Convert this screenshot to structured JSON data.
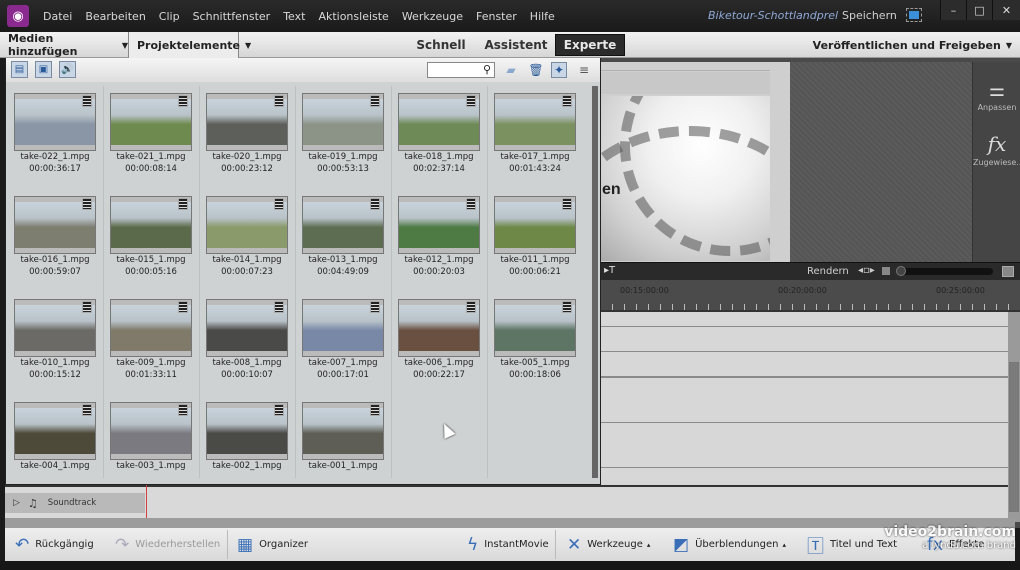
{
  "menubar": {
    "items": [
      "Datei",
      "Bearbeiten",
      "Clip",
      "Schnittfenster",
      "Text",
      "Aktionsleiste",
      "Werkzeuge",
      "Fenster",
      "Hilfe"
    ],
    "project_title": "Biketour-Schottlandprel",
    "save_label": "Speichern",
    "window_controls": {
      "minimize": "–",
      "maximize": "□",
      "close": "✕"
    }
  },
  "modebar": {
    "add_media": "Medien hinzufügen",
    "project_assets": "Projektelemente",
    "tabs": [
      {
        "label": "Schnell",
        "active": false
      },
      {
        "label": "Assistent",
        "active": false
      },
      {
        "label": "Experte",
        "active": true
      }
    ],
    "publish": "Veröffentlichen und Freigeben"
  },
  "project_panel": {
    "filters": [
      {
        "name": "video-filter-icon",
        "glyph": "▤"
      },
      {
        "name": "image-filter-icon",
        "glyph": "▣"
      },
      {
        "name": "audio-filter-icon",
        "glyph": "🔊"
      }
    ],
    "search_placeholder": "",
    "clips": [
      {
        "name": "take-022_1.mpg",
        "duration": "00:00:36:17",
        "color": "#8a96a6"
      },
      {
        "name": "take-021_1.mpg",
        "duration": "00:00:08:14",
        "color": "#6f8a4e"
      },
      {
        "name": "take-020_1.mpg",
        "duration": "00:00:23:12",
        "color": "#5d5f5a"
      },
      {
        "name": "take-019_1.mpg",
        "duration": "00:00:53:13",
        "color": "#8c9488"
      },
      {
        "name": "take-018_1.mpg",
        "duration": "00:02:37:14",
        "color": "#6e8a56"
      },
      {
        "name": "take-017_1.mpg",
        "duration": "00:01:43:24",
        "color": "#7b9160"
      },
      {
        "name": "take-016_1.mpg",
        "duration": "00:00:59:07",
        "color": "#7d7d70"
      },
      {
        "name": "take-015_1.mpg",
        "duration": "00:00:05:16",
        "color": "#5a6a4a"
      },
      {
        "name": "take-014_1.mpg",
        "duration": "00:00:07:23",
        "color": "#8a9a6a"
      },
      {
        "name": "take-013_1.mpg",
        "duration": "00:04:49:09",
        "color": "#5d6d52"
      },
      {
        "name": "take-012_1.mpg",
        "duration": "00:00:20:03",
        "color": "#4e7a44"
      },
      {
        "name": "take-011_1.mpg",
        "duration": "00:00:06:21",
        "color": "#6e8848"
      },
      {
        "name": "take-010_1.mpg",
        "duration": "00:00:15:12",
        "color": "#6c6a66"
      },
      {
        "name": "take-009_1.mpg",
        "duration": "00:01:33:11",
        "color": "#7f7a6a"
      },
      {
        "name": "take-008_1.mpg",
        "duration": "00:00:10:07",
        "color": "#4a4a48"
      },
      {
        "name": "take-007_1.mpg",
        "duration": "00:00:17:01",
        "color": "#7a88a8"
      },
      {
        "name": "take-006_1.mpg",
        "duration": "00:00:22:17",
        "color": "#6a5040"
      },
      {
        "name": "take-005_1.mpg",
        "duration": "00:00:18:06",
        "color": "#5e7464"
      },
      {
        "name": "take-004_1.mpg",
        "duration": "",
        "color": "#4e4a3a"
      },
      {
        "name": "take-003_1.mpg",
        "duration": "",
        "color": "#7a7a80"
      },
      {
        "name": "take-002_1.mpg",
        "duration": "",
        "color": "#4a4a46"
      },
      {
        "name": "take-001_1.mpg",
        "duration": "",
        "color": "#5f5e56"
      }
    ]
  },
  "monitor": {
    "title_text_fragment": "en"
  },
  "side_panel": {
    "adjust": "Anpassen",
    "applied": "Zugewiese..."
  },
  "timeline": {
    "render_label": "Rendern",
    "timecodes": [
      "00:15:00:00",
      "00:20:00:00",
      "00:25:00:00"
    ],
    "soundtrack_label": "Soundtrack"
  },
  "actionbar": {
    "undo": "Rückgängig",
    "redo": "Wiederherstellen",
    "organizer": "Organizer",
    "instant_movie": "InstantMovie",
    "tools": "Werkzeuge",
    "transitions": "Überblendungen",
    "titles": "Titel und Text",
    "effects": "Effekte"
  },
  "watermark": {
    "line1": "video2brain.com",
    "line2": "a lynda.com brand"
  }
}
